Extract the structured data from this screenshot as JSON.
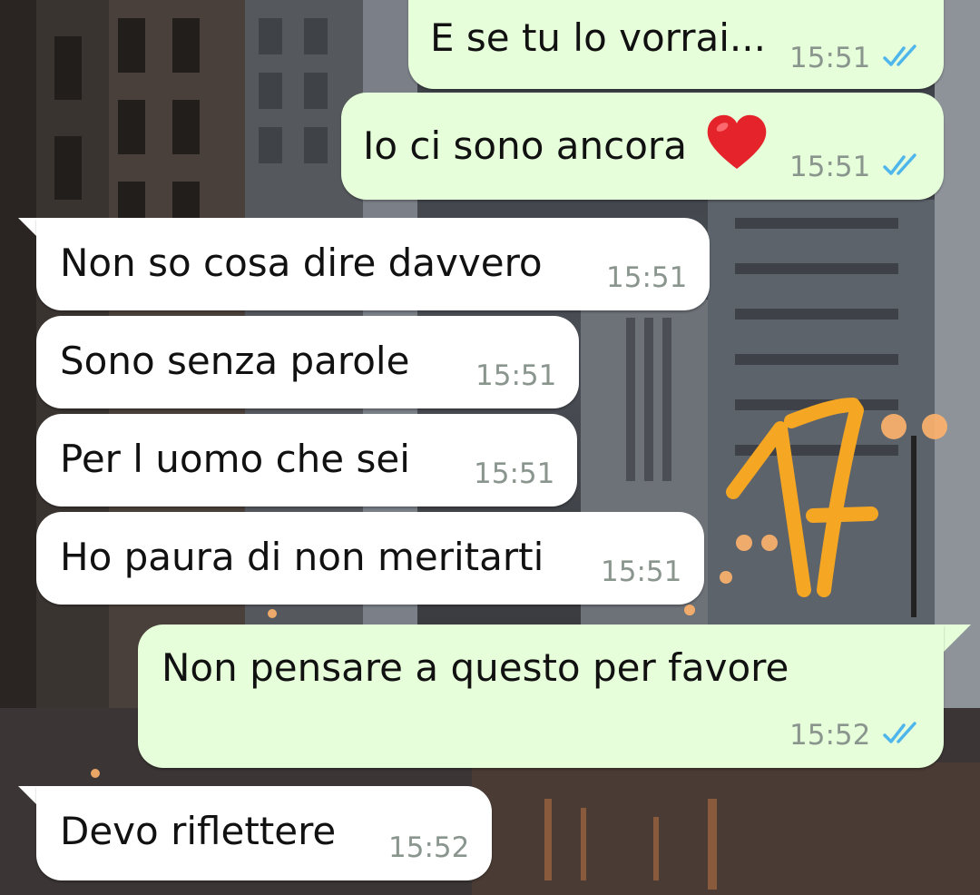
{
  "chat": {
    "messages": [
      {
        "direction": "out",
        "text": "E se tu lo vorrai...",
        "time": "15:51",
        "status": "read"
      },
      {
        "direction": "out",
        "text": "Io ci sono ancora",
        "time": "15:51",
        "status": "read",
        "emoji": "red-heart"
      },
      {
        "direction": "in",
        "text": "Non so cosa dire davvero",
        "time": "15:51"
      },
      {
        "direction": "in",
        "text": "Sono senza parole",
        "time": "15:51"
      },
      {
        "direction": "in",
        "text": "Per l uomo che sei",
        "time": "15:51"
      },
      {
        "direction": "in",
        "text": "Ho paura di non meritarti",
        "time": "15:51"
      },
      {
        "direction": "out",
        "text": "Non pensare a questo per favore",
        "time": "15:52",
        "status": "read"
      },
      {
        "direction": "in",
        "text": "Devo riflettere",
        "time": "15:52"
      }
    ]
  },
  "annotation": {
    "text": "17",
    "color": "#f5a623"
  },
  "colors": {
    "outgoing_bubble": "#e6ffda",
    "incoming_bubble": "#ffffff",
    "read_ticks": "#4fb6ec",
    "timestamp": "#8a958e"
  }
}
